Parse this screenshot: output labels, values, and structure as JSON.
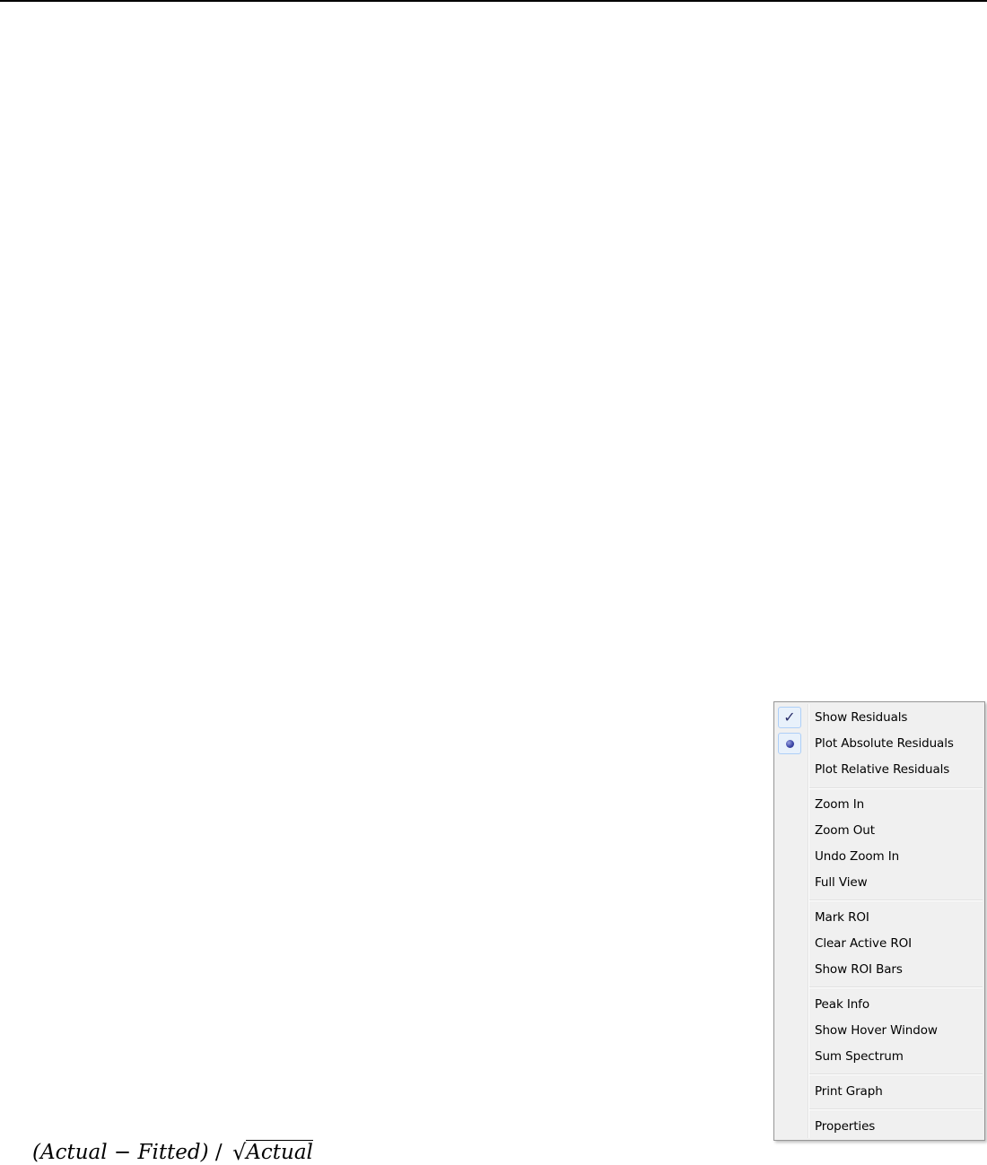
{
  "menu": {
    "items": [
      {
        "label": "Show Residuals",
        "indicator": "check-icon"
      },
      {
        "label": "Plot Absolute Residuals",
        "indicator": "radio-dot-icon"
      },
      {
        "label": "Plot Relative Residuals"
      },
      {
        "label": "Zoom In"
      },
      {
        "label": "Zoom Out"
      },
      {
        "label": "Undo Zoom In"
      },
      {
        "label": "Full View"
      },
      {
        "label": "Mark ROI"
      },
      {
        "label": "Clear Active ROI"
      },
      {
        "label": "Show ROI Bars"
      },
      {
        "label": "Peak Info"
      },
      {
        "label": "Show Hover Window"
      },
      {
        "label": "Sum Spectrum"
      },
      {
        "label": "Print Graph"
      },
      {
        "label": "Properties"
      }
    ],
    "check_glyph": "✓",
    "colors": {
      "background": "#f0f0f0",
      "border": "#979797",
      "highlight_border": "#aecff7",
      "highlight_fill": "#e8f1fb",
      "indicator": "#2b2f6b"
    }
  },
  "formula": {
    "numerator_open": "(Actual",
    "minus": " − ",
    "fitted": "Fitted)",
    "slash": " / ",
    "sqrt_symbol": "√",
    "radicand": "Actual"
  }
}
